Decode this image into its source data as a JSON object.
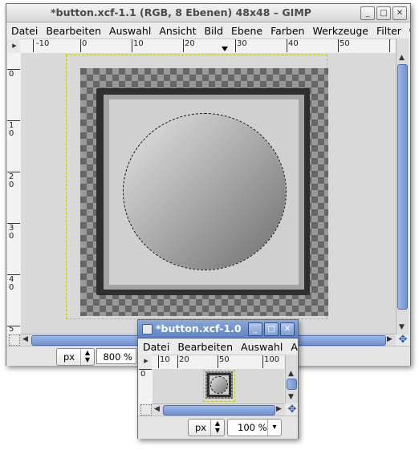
{
  "main_window": {
    "title": "*button.xcf-1.1 (RGB, 8 Ebenen) 48x48 – GIMP",
    "controls": {
      "minimize": "_",
      "maximize": "□",
      "close": "✕"
    },
    "menu": [
      "Datei",
      "Bearbeiten",
      "Auswahl",
      "Ansicht",
      "Bild",
      "Ebene",
      "Farben",
      "Werkzeuge",
      "Filter",
      "Ꮳ"
    ],
    "ruler_h_labels": [
      "-10",
      "0",
      "10",
      "20",
      "30",
      "40",
      "50"
    ],
    "ruler_v_labels": [
      "0",
      "1 0",
      "2 0",
      "3 0",
      "4 0",
      "5"
    ],
    "unit": "px",
    "zoom": "800 %"
  },
  "small_window": {
    "title": "*button.xcf-1.0",
    "menu": [
      "Datei",
      "Bearbeiten",
      "Auswahl",
      "An"
    ],
    "ruler_h_labels": [
      "10",
      "20",
      "50",
      "100"
    ],
    "ruler_v_labels": [
      "0"
    ],
    "unit": "px",
    "zoom": "100 %"
  },
  "colors": {
    "accent": "#5b82c3",
    "scroll_thumb": "#7f9fd8",
    "canvas_bg": "#d9d9d9",
    "button_face": "#c9c9c9",
    "button_border": "#333333",
    "selection": "#e5e600"
  }
}
